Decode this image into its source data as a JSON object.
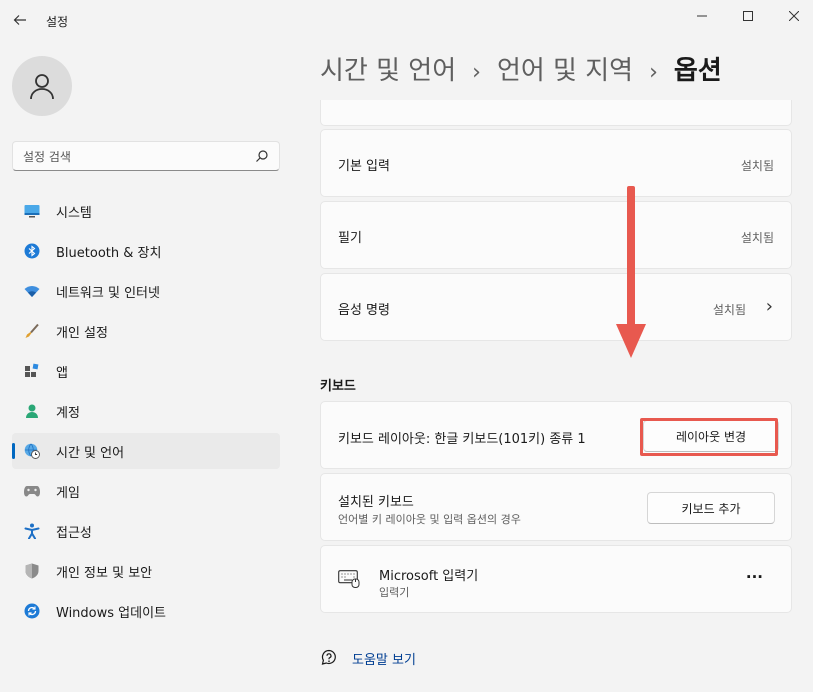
{
  "app": {
    "title": "설정"
  },
  "search": {
    "placeholder": "설정 검색"
  },
  "sidebar": {
    "items": [
      {
        "label": "시스템",
        "icon": "monitor-icon"
      },
      {
        "label": "Bluetooth & 장치",
        "icon": "bluetooth-icon"
      },
      {
        "label": "네트워크 및 인터넷",
        "icon": "wifi-icon"
      },
      {
        "label": "개인 설정",
        "icon": "brush-icon"
      },
      {
        "label": "앱",
        "icon": "apps-icon"
      },
      {
        "label": "계정",
        "icon": "person-icon"
      },
      {
        "label": "시간 및 언어",
        "icon": "globe-clock-icon",
        "active": true
      },
      {
        "label": "게임",
        "icon": "gamepad-icon"
      },
      {
        "label": "접근성",
        "icon": "accessibility-icon"
      },
      {
        "label": "개인 정보 및 보안",
        "icon": "shield-icon"
      },
      {
        "label": "Windows 업데이트",
        "icon": "update-icon"
      }
    ]
  },
  "breadcrumb": {
    "parts": [
      "시간 및 언어",
      "언어 및 지역"
    ],
    "separator": "›",
    "current": "옵션"
  },
  "features": [
    {
      "label": "기본 입력",
      "status": "설치됨"
    },
    {
      "label": "필기",
      "status": "설치됨"
    },
    {
      "label": "음성 명령",
      "status": "설치됨",
      "chevron": "›"
    }
  ],
  "keyboard": {
    "section_title": "키보드",
    "layout_label": "키보드 레이아웃: 한글 키보드(101키) 종류 1",
    "layout_button": "레이아웃 변경",
    "installed_title": "설치된 키보드",
    "installed_subtitle": "언어별 키 레이아웃 및 입력 옵션의 경우",
    "add_button": "키보드 추가",
    "ime": {
      "name": "Microsoft 입력기",
      "type": "입력기",
      "more": "···"
    }
  },
  "help": {
    "label": "도움말 보기"
  },
  "colors": {
    "accent": "#0067c0",
    "annotation": "#e8594f",
    "link": "#003e92"
  }
}
